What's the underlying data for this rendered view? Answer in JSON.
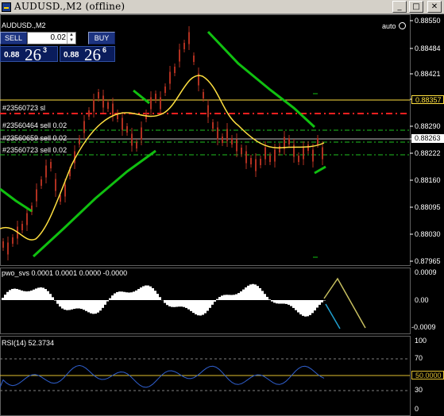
{
  "window": {
    "title": "AUDUSD.,M2 (offline)",
    "buttons": [
      "_",
      "□",
      "✕"
    ]
  },
  "chart": {
    "symbol_label": "AUDUSD.,M2",
    "auto_label": "auto",
    "price_axis": [
      "0.88550",
      "0.88484",
      "0.88421",
      "0.88357",
      "0.88290",
      "0.88263",
      "0.88222",
      "0.88160",
      "0.88095",
      "0.88030",
      "0.87965"
    ],
    "price_tag_yellow": "0.88357",
    "price_tag_current": "0.88263",
    "order_labels": [
      {
        "text": "#23560723 sl",
        "color": "#ff2020"
      },
      {
        "text": "#23560464 sell 0.02",
        "color": "#20c020"
      },
      {
        "text": "#23560659 sell 0.02",
        "color": "#20c020"
      },
      {
        "text": "#23560723 sell 0.02",
        "color": "#20c020"
      }
    ]
  },
  "trade_panel": {
    "sell_label": "SELL",
    "buy_label": "BUY",
    "lot_value": "0.02",
    "bid_small": "0.88",
    "bid_big": "26",
    "bid_sup": "3",
    "ask_small": "0.88",
    "ask_big": "26",
    "ask_sup": "6"
  },
  "pwo_panel": {
    "title": "pwo_svs 0.0001 0.0001 0.0000 -0.0000",
    "axis": [
      "0.0009",
      "0.00",
      "-0.0009"
    ]
  },
  "rsi_panel": {
    "title": "RSI(14) 52.3734",
    "axis": [
      "100",
      "70",
      "50.0000",
      "30",
      "0"
    ],
    "value_tag": "50.0000"
  },
  "colors": {
    "candle": "#b03020",
    "ma_yellow": "#ffe040",
    "band_green": "#10c010",
    "sl_red": "#ff2020",
    "order_green": "#20c020",
    "rsi_line": "#3060d0",
    "level_yellow": "#e0c030"
  }
}
